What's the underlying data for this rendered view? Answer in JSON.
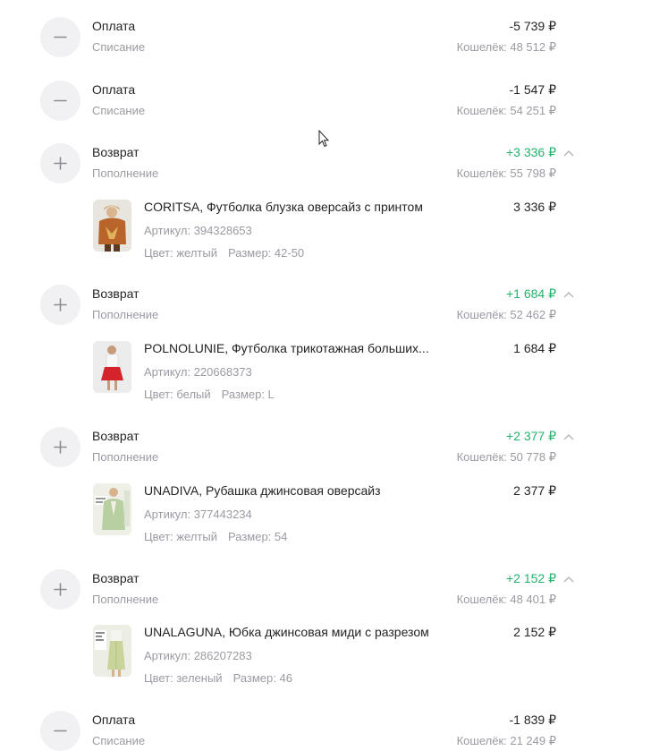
{
  "transactions": [
    {
      "type": "Оплата",
      "sub": "Списание",
      "amount": "-5 739 ₽",
      "balance": "Кошелёк: 48 512 ₽",
      "icon": "minus-icon"
    },
    {
      "type": "Оплата",
      "sub": "Списание",
      "amount": "-1 547 ₽",
      "balance": "Кошелёк: 54 251 ₽",
      "icon": "minus-icon"
    },
    {
      "type": "Возврат",
      "sub": "Пополнение",
      "amount": "+3 336 ₽",
      "balance": "Кошелёк: 55 798 ₽",
      "icon": "plus-icon",
      "item": {
        "name": "CORITSA, Футболка блузка оверсайз с принтом",
        "article": "Артикул: 394328653",
        "color": "Цвет: желтый",
        "size": "Размер: 42-50",
        "price": "3 336 ₽"
      }
    },
    {
      "type": "Возврат",
      "sub": "Пополнение",
      "amount": "+1 684 ₽",
      "balance": "Кошелёк: 52 462 ₽",
      "icon": "plus-icon",
      "item": {
        "name": "POLNOLUNIE, Футболка трикотажная больших...",
        "article": "Артикул: 220668373",
        "color": "Цвет: белый",
        "size": "Размер: L",
        "price": "1 684 ₽"
      }
    },
    {
      "type": "Возврат",
      "sub": "Пополнение",
      "amount": "+2 377 ₽",
      "balance": "Кошелёк: 50 778 ₽",
      "icon": "plus-icon",
      "item": {
        "name": "UNADIVA, Рубашка джинсовая оверсайз",
        "article": "Артикул: 377443234",
        "color": "Цвет: желтый",
        "size": "Размер: 54",
        "price": "2 377 ₽"
      }
    },
    {
      "type": "Возврат",
      "sub": "Пополнение",
      "amount": "+2 152 ₽",
      "balance": "Кошелёк: 48 401 ₽",
      "icon": "plus-icon",
      "item": {
        "name": "UNALAGUNA, Юбка джинсовая миди с разрезом",
        "article": "Артикул: 286207283",
        "color": "Цвет: зеленый",
        "size": "Размер: 46",
        "price": "2 152 ₽"
      }
    },
    {
      "type": "Оплата",
      "sub": "Списание",
      "amount": "-1 839 ₽",
      "balance": "Кошелёк: 21 249 ₽",
      "icon": "minus-icon"
    }
  ],
  "colors": {
    "positive": "#23b26d",
    "muted": "#9a9ba3",
    "circle_bg": "#f1f1f4"
  }
}
